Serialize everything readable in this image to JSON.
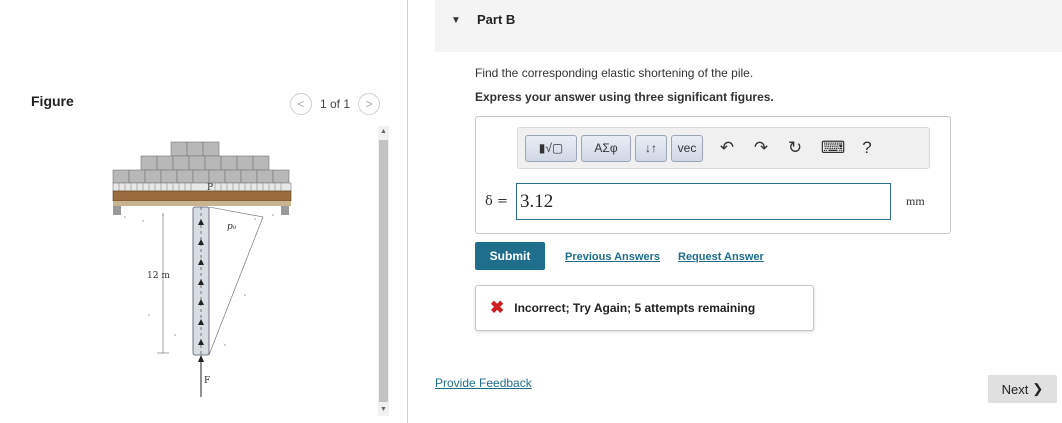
{
  "figure_panel": {
    "title": "Figure",
    "pager": {
      "prev": "<",
      "next": ">",
      "count": "1 of 1"
    },
    "figure_labels": {
      "p_top": "P",
      "p0": "p₀",
      "length": "12 m",
      "f": "F"
    }
  },
  "part": {
    "caret": "▼",
    "label": "Part B"
  },
  "question": "Find the corresponding elastic shortening of the pile.",
  "instruction": "Express your answer using three significant figures.",
  "toolbar": {
    "templates": "▮√▢",
    "greek": "ΑΣφ",
    "arrows": "↓↑",
    "vec": "vec",
    "undo": "↶",
    "redo": "↷",
    "reset": "↻",
    "keyboard": "⌨",
    "help": "?"
  },
  "answer": {
    "symbol": "δ =",
    "value": "3.12",
    "unit": "mm"
  },
  "submit_label": "Submit",
  "links": {
    "previous": "Previous Answers",
    "request": "Request Answer",
    "provide_feedback": "Provide Feedback"
  },
  "feedback": {
    "icon": "✖",
    "text": "Incorrect; Try Again; 5 attempts remaining"
  },
  "next_label": "Next",
  "next_icon": "❯"
}
